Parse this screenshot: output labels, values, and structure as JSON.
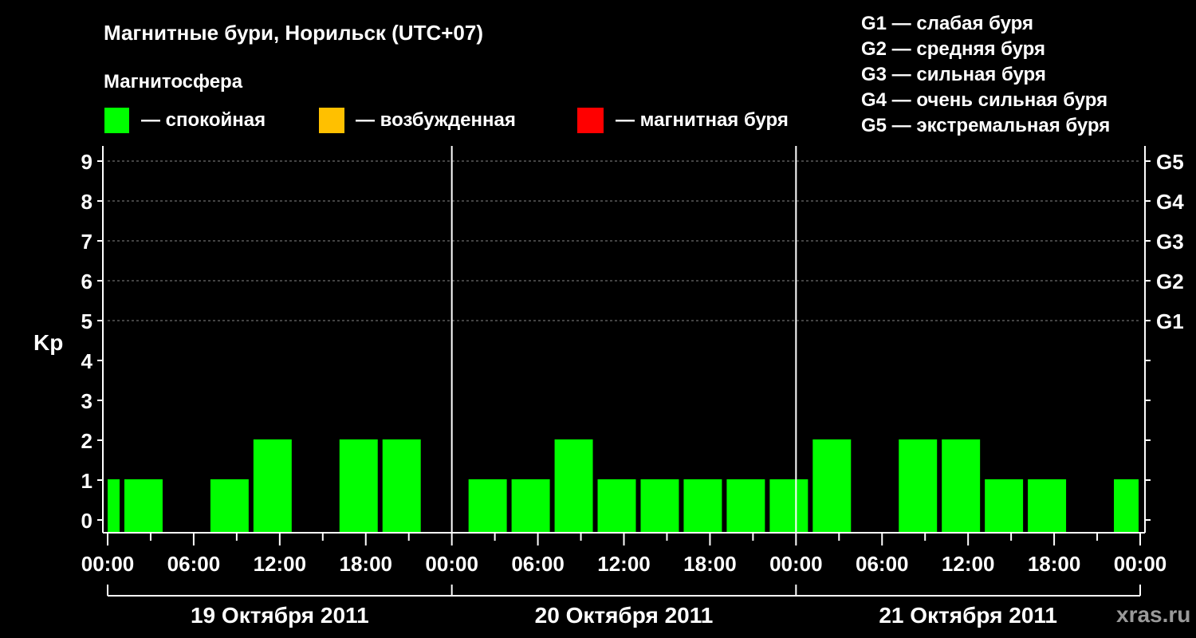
{
  "chart_data": {
    "type": "bar",
    "title": "Магнитные бури, Норильск (UTC+07)",
    "ylabel": "Kp",
    "ylim": [
      0,
      9
    ],
    "yticks": [
      "0",
      "1",
      "2",
      "3",
      "4",
      "5",
      "6",
      "7",
      "8",
      "9"
    ],
    "storm_levels": [
      {
        "kp": 5,
        "label": "G1"
      },
      {
        "kp": 6,
        "label": "G2"
      },
      {
        "kp": 7,
        "label": "G3"
      },
      {
        "kp": 8,
        "label": "G4"
      },
      {
        "kp": 9,
        "label": "G5"
      }
    ],
    "storm_legend": [
      "G1 — слабая буря",
      "G2 — средняя буря",
      "G3 — сильная буря",
      "G4 — очень сильная буря",
      "G5 — экстремальная буря"
    ],
    "magnetosphere": {
      "title": "Магнитосфера",
      "items": [
        {
          "label": "— спокойная",
          "color": "#00ff00"
        },
        {
          "label": "— возбужденная",
          "color": "#ffc000"
        },
        {
          "label": "— магнитная буря",
          "color": "#ff0000"
        }
      ]
    },
    "x_tick_labels": [
      "00:00",
      "06:00",
      "12:00",
      "18:00",
      "00:00",
      "06:00",
      "12:00",
      "18:00",
      "00:00",
      "06:00",
      "12:00",
      "18:00",
      "00:00"
    ],
    "days": [
      "19 Октября 2011",
      "20 Октября 2011",
      "21 Октября 2011"
    ],
    "bar_color": "#00ff00",
    "series": [
      {
        "values": [
          {
            "start": "19 Октября 2011 00:00",
            "end": "19 Октября 2011 01:00",
            "kp": 1
          },
          {
            "start": "19 Октября 2011 01:00",
            "end": "19 Октября 2011 04:00",
            "kp": 1
          },
          {
            "start": "19 Октября 2011 04:00",
            "end": "19 Октября 2011 07:00",
            "kp": 0
          },
          {
            "start": "19 Октября 2011 07:00",
            "end": "19 Октября 2011 10:00",
            "kp": 1
          },
          {
            "start": "19 Октября 2011 10:00",
            "end": "19 Октября 2011 13:00",
            "kp": 2
          },
          {
            "start": "19 Октября 2011 13:00",
            "end": "19 Октября 2011 16:00",
            "kp": 0
          },
          {
            "start": "19 Октября 2011 16:00",
            "end": "19 Октября 2011 19:00",
            "kp": 2
          },
          {
            "start": "19 Октября 2011 19:00",
            "end": "19 Октября 2011 22:00",
            "kp": 2
          },
          {
            "start": "19 Октября 2011 22:00",
            "end": "20 Октября 2011 01:00",
            "kp": 0
          },
          {
            "start": "20 Октября 2011 01:00",
            "end": "20 Октября 2011 04:00",
            "kp": 1
          },
          {
            "start": "20 Октября 2011 04:00",
            "end": "20 Октября 2011 07:00",
            "kp": 1
          },
          {
            "start": "20 Октября 2011 07:00",
            "end": "20 Октября 2011 10:00",
            "kp": 2
          },
          {
            "start": "20 Октября 2011 10:00",
            "end": "20 Октября 2011 13:00",
            "kp": 1
          },
          {
            "start": "20 Октября 2011 13:00",
            "end": "20 Октября 2011 16:00",
            "kp": 1
          },
          {
            "start": "20 Октября 2011 16:00",
            "end": "20 Октября 2011 19:00",
            "kp": 1
          },
          {
            "start": "20 Октября 2011 19:00",
            "end": "20 Октября 2011 22:00",
            "kp": 1
          },
          {
            "start": "20 Октября 2011 22:00",
            "end": "21 Октября 2011 01:00",
            "kp": 1
          },
          {
            "start": "21 Октября 2011 01:00",
            "end": "21 Октября 2011 04:00",
            "kp": 2
          },
          {
            "start": "21 Октября 2011 04:00",
            "end": "21 Октября 2011 07:00",
            "kp": 0
          },
          {
            "start": "21 Октября 2011 07:00",
            "end": "21 Октября 2011 10:00",
            "kp": 2
          },
          {
            "start": "21 Октября 2011 10:00",
            "end": "21 Октября 2011 13:00",
            "kp": 2
          },
          {
            "start": "21 Октября 2011 13:00",
            "end": "21 Октября 2011 16:00",
            "kp": 1
          },
          {
            "start": "21 Октября 2011 16:00",
            "end": "21 Октября 2011 19:00",
            "kp": 1
          },
          {
            "start": "21 Октября 2011 19:00",
            "end": "21 Октября 2011 22:00",
            "kp": 0
          },
          {
            "start": "21 Октября 2011 22:00",
            "end": "22 Октября 2011 00:00",
            "kp": 1
          }
        ]
      }
    ],
    "grid": true
  },
  "watermark": "xras.ru"
}
